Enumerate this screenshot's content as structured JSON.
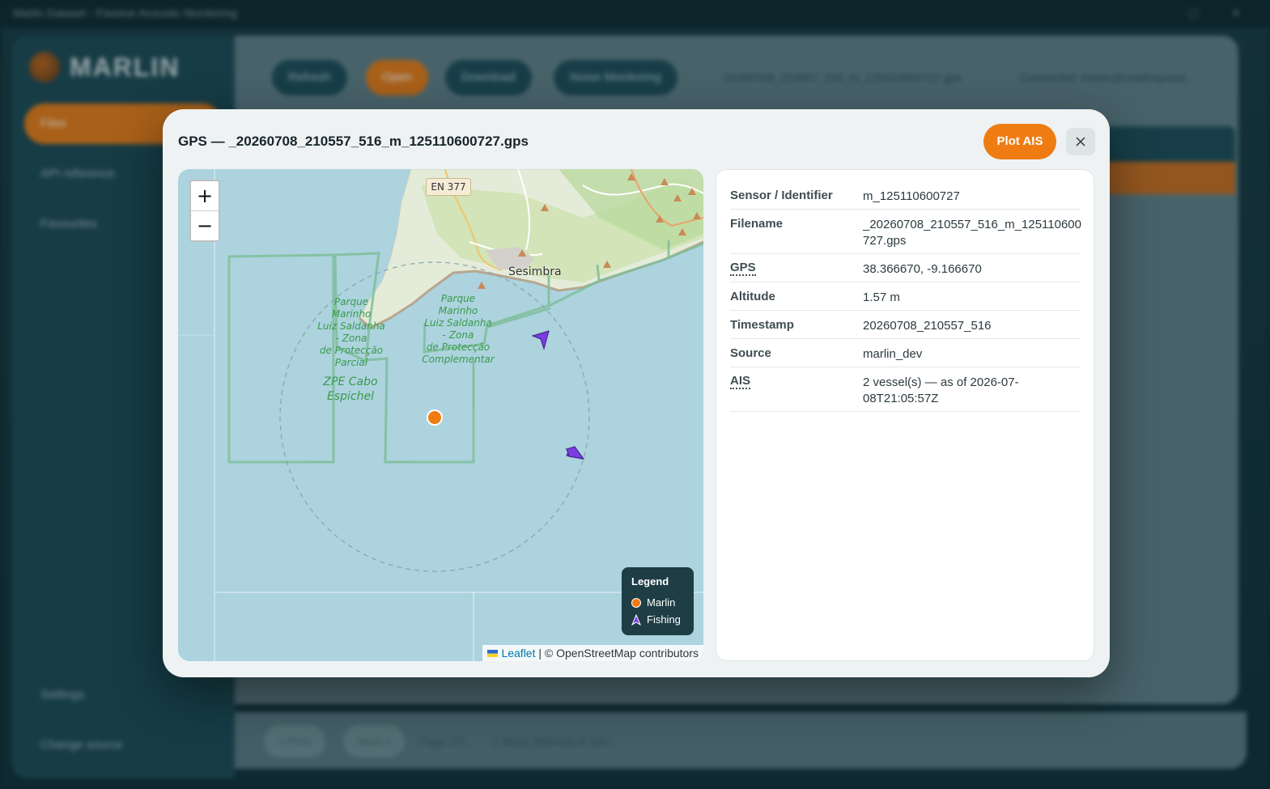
{
  "window": {
    "title": "Marlin Dataset - Passive Acoustic Monitoring"
  },
  "app": {
    "logo_text": "MARLIN",
    "sidebar": {
      "items": [
        "Files",
        "API reference",
        "Favourites"
      ],
      "footer": [
        "Settings",
        "Change source"
      ]
    },
    "toolbar": {
      "buttons": [
        "Refresh",
        "Open",
        "Download",
        "Noise Monitoring"
      ],
      "status": "20260708_210557_516_m_125110600727.gps",
      "status2": "Connected: marlin@marlinspeed..."
    },
    "pager": {
      "buttons": [
        "« Prev",
        "Next »"
      ],
      "page": "Page 1/1",
      "summary": "1 file(s) (filtered) of 430"
    }
  },
  "modal": {
    "title": "GPS — _20260708_210557_516_m_125110600727.gps",
    "plot_ais_label": "Plot AIS",
    "close_icon": "close-icon"
  },
  "map": {
    "zoom_in": "+",
    "zoom_out": "−",
    "road_label": "EN 377",
    "town": "Sesimbra",
    "zone_label_1": [
      "Parque",
      "Marinho",
      "Luiz Saldanha",
      "- Zona",
      "de Protecção",
      "Parcial"
    ],
    "zone_label_2": [
      "Parque",
      "Marinho",
      "Luiz Saldanha",
      "- Zona",
      "de Protecção",
      "Complementar"
    ],
    "zpe_label": [
      "ZPE Cabo",
      "Espichel"
    ],
    "legend": {
      "title": "Legend",
      "items": [
        {
          "label": "Marlin",
          "color": "#ef7c12"
        },
        {
          "label": "Fishing",
          "color": "#7a3ce0"
        }
      ]
    },
    "attribution": {
      "leaflet": "Leaflet",
      "rest": "| © OpenStreetMap contributors"
    }
  },
  "details": {
    "rows": [
      {
        "key": "Sensor / Identifier",
        "value": "m_125110600727"
      },
      {
        "key": "Filename",
        "value": "_20260708_210557_516_m_125110600727.gps"
      },
      {
        "key": "GPS",
        "value": "38.366670, -9.166670"
      },
      {
        "key": "Altitude",
        "value": "1.57 m"
      },
      {
        "key": "Timestamp",
        "value": "20260708_210557_516"
      },
      {
        "key": "Source",
        "value": "marlin_dev"
      },
      {
        "key": "AIS",
        "value": "2 vessel(s) — as of 2026-07-08T21:05:57Z"
      }
    ]
  }
}
